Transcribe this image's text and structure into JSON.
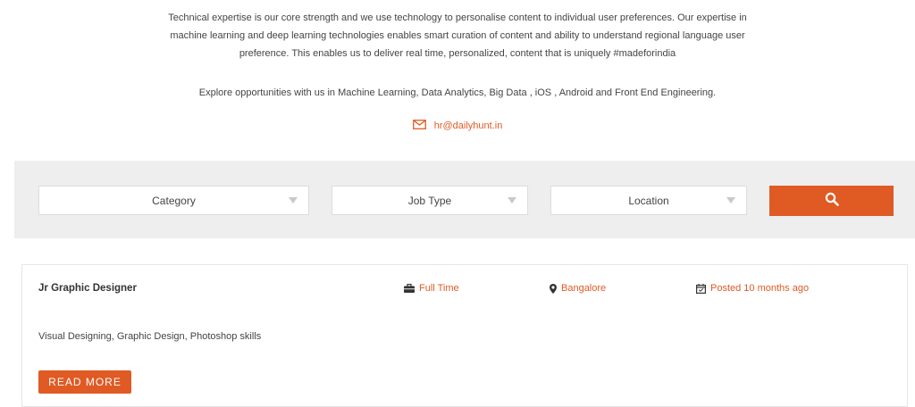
{
  "intro": {
    "paragraph1": "Technical expertise is our core strength and we use technology to personalise content to individual user preferences. Our expertise in machine learning and deep learning technologies enables smart curation of content and ability to understand regional language user preference. This enables us to deliver real time, personalized, content that is uniquely #madeforindia",
    "paragraph2": "Explore opportunities with us in Machine Learning, Data Analytics, Big Data , iOS , Android and Front End Engineering.",
    "email": "hr@dailyhunt.in"
  },
  "filters": {
    "category": "Category",
    "job_type": "Job Type",
    "location": "Location",
    "search_icon": "search-icon"
  },
  "job": {
    "title": "Jr Graphic Designer",
    "type": "Full Time",
    "location": "Bangalore",
    "posted": "Posted 10 months ago",
    "skills": "Visual Designing, Graphic Design, Photoshop skills",
    "read_more": "READ MORE"
  },
  "colors": {
    "accent": "#e05a24",
    "filter_bg": "#eeeeee"
  }
}
